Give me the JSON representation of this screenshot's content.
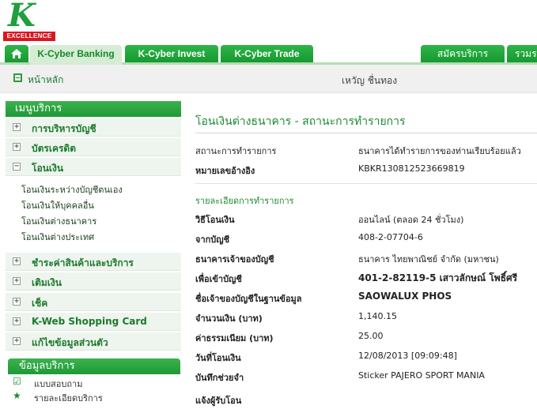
{
  "logo": {
    "letter": "K",
    "text": "EXCELLENCE"
  },
  "tabs": {
    "home_icon": "home-icon",
    "items": [
      "K-Cyber Banking",
      "K-Cyber Invest",
      "K-Cyber Trade"
    ],
    "right_items": [
      "สมัครบริการ",
      "รวมร"
    ]
  },
  "subbar": {
    "home_label": "หน้าหลัก",
    "user_name": "เหวัญ ชื่นทอง"
  },
  "sidebar": {
    "menu_title": "เมนูบริการ",
    "groups": [
      {
        "label": "การบริหารบัญชี",
        "sign": "+"
      },
      {
        "label": "บัตรเครดิต",
        "sign": "+"
      },
      {
        "label": "โอนเงิน",
        "sign": "−"
      },
      {
        "label": "ชำระค่าสินค้าและบริการ",
        "sign": "+"
      },
      {
        "label": "เติมเงิน",
        "sign": "+"
      },
      {
        "label": "เช็ค",
        "sign": "+"
      },
      {
        "label": "K-Web Shopping Card",
        "sign": "+"
      },
      {
        "label": "แก้ไขข้อมูลส่วนตัว",
        "sign": "+"
      }
    ],
    "transfer_sub": [
      "โอนเงินระหว่างบัญชีตนเอง",
      "โอนเงินให้บุคคลอื่น",
      "โอนเงินต่างธนาคาร",
      "โอนเงินต่างประเทศ"
    ],
    "info_title": "ข้อมูลบริการ",
    "info_items": [
      "แบบสอบถาม",
      "รายละเอียดบริการ"
    ]
  },
  "main": {
    "title": "โอนเงินต่างธนาคาร - สถานะการทำรายการ",
    "status_label": "สถานะการทำรายการ",
    "status_value": "ธนาคารได้ทำรายการของท่านเรียบร้อยแล้ว",
    "ref_label": "หมายเลขอ้างอิง",
    "ref_value": "KBKR130812523669819",
    "details_title": "รายละเอียดการทำรายการ",
    "rows": [
      {
        "label": "วิธีโอนเงิน",
        "value": "ออนไลน์ (ตลอด 24 ชั่วโมง)"
      },
      {
        "label": "จากบัญชี",
        "value": "408-2-07704-6"
      },
      {
        "label": "ธนาคารเจ้าของบัญชี",
        "value": "ธนาคาร ไทยพาณิชย์ จำกัด (มหาชน)"
      },
      {
        "label": "เพื่อเข้าบัญชี",
        "value": "401-2-82119-5 เสาวลักษณ์ โพธิ์ศรี"
      },
      {
        "label": "ชื่อเจ้าของบัญชีในฐานข้อมูล",
        "value": "SAOWALUX PHOS"
      },
      {
        "label": "จำนวนเงิน (บาท)",
        "value": "1,140.15"
      },
      {
        "label": "ค่าธรรมเนียม (บาท)",
        "value": "25.00"
      },
      {
        "label": "วันที่โอนเงิน",
        "value": "12/08/2013 [09:09:48]"
      },
      {
        "label": "บันทึกช่วยจำ",
        "value": "Sticker PAJERO SPORT MANIA"
      },
      {
        "label": "แจ้งผู้รับโอน",
        "value": ""
      }
    ]
  }
}
